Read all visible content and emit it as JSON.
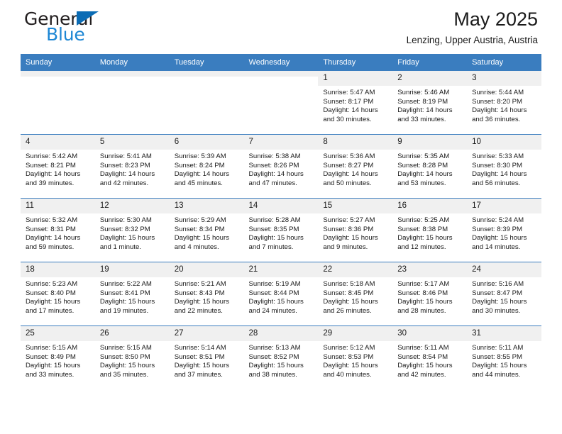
{
  "brand": {
    "word1": "General",
    "word2": "Blue",
    "triangle_color": "#0b6cb5",
    "blue_text_color": "#1c86d4"
  },
  "header": {
    "title": "May 2025",
    "subtitle": "Lenzing, Upper Austria, Austria"
  },
  "theme": {
    "header_bg": "#3a7dbf",
    "daynum_bg": "#f0f0f0",
    "grid_line": "#3a7dbf",
    "text": "#1a1a1a"
  },
  "calendar": {
    "weekday_headers": [
      "Sunday",
      "Monday",
      "Tuesday",
      "Wednesday",
      "Thursday",
      "Friday",
      "Saturday"
    ],
    "weeks": [
      [
        {
          "day": "",
          "empty": true,
          "sunrise": "",
          "sunset": "",
          "daylight1": "",
          "daylight2": ""
        },
        {
          "day": "",
          "empty": true,
          "sunrise": "",
          "sunset": "",
          "daylight1": "",
          "daylight2": ""
        },
        {
          "day": "",
          "empty": true,
          "sunrise": "",
          "sunset": "",
          "daylight1": "",
          "daylight2": ""
        },
        {
          "day": "",
          "empty": true,
          "sunrise": "",
          "sunset": "",
          "daylight1": "",
          "daylight2": ""
        },
        {
          "day": "1",
          "empty": false,
          "sunrise": "Sunrise: 5:47 AM",
          "sunset": "Sunset: 8:17 PM",
          "daylight1": "Daylight: 14 hours",
          "daylight2": "and 30 minutes."
        },
        {
          "day": "2",
          "empty": false,
          "sunrise": "Sunrise: 5:46 AM",
          "sunset": "Sunset: 8:19 PM",
          "daylight1": "Daylight: 14 hours",
          "daylight2": "and 33 minutes."
        },
        {
          "day": "3",
          "empty": false,
          "sunrise": "Sunrise: 5:44 AM",
          "sunset": "Sunset: 8:20 PM",
          "daylight1": "Daylight: 14 hours",
          "daylight2": "and 36 minutes."
        }
      ],
      [
        {
          "day": "4",
          "empty": false,
          "sunrise": "Sunrise: 5:42 AM",
          "sunset": "Sunset: 8:21 PM",
          "daylight1": "Daylight: 14 hours",
          "daylight2": "and 39 minutes."
        },
        {
          "day": "5",
          "empty": false,
          "sunrise": "Sunrise: 5:41 AM",
          "sunset": "Sunset: 8:23 PM",
          "daylight1": "Daylight: 14 hours",
          "daylight2": "and 42 minutes."
        },
        {
          "day": "6",
          "empty": false,
          "sunrise": "Sunrise: 5:39 AM",
          "sunset": "Sunset: 8:24 PM",
          "daylight1": "Daylight: 14 hours",
          "daylight2": "and 45 minutes."
        },
        {
          "day": "7",
          "empty": false,
          "sunrise": "Sunrise: 5:38 AM",
          "sunset": "Sunset: 8:26 PM",
          "daylight1": "Daylight: 14 hours",
          "daylight2": "and 47 minutes."
        },
        {
          "day": "8",
          "empty": false,
          "sunrise": "Sunrise: 5:36 AM",
          "sunset": "Sunset: 8:27 PM",
          "daylight1": "Daylight: 14 hours",
          "daylight2": "and 50 minutes."
        },
        {
          "day": "9",
          "empty": false,
          "sunrise": "Sunrise: 5:35 AM",
          "sunset": "Sunset: 8:28 PM",
          "daylight1": "Daylight: 14 hours",
          "daylight2": "and 53 minutes."
        },
        {
          "day": "10",
          "empty": false,
          "sunrise": "Sunrise: 5:33 AM",
          "sunset": "Sunset: 8:30 PM",
          "daylight1": "Daylight: 14 hours",
          "daylight2": "and 56 minutes."
        }
      ],
      [
        {
          "day": "11",
          "empty": false,
          "sunrise": "Sunrise: 5:32 AM",
          "sunset": "Sunset: 8:31 PM",
          "daylight1": "Daylight: 14 hours",
          "daylight2": "and 59 minutes."
        },
        {
          "day": "12",
          "empty": false,
          "sunrise": "Sunrise: 5:30 AM",
          "sunset": "Sunset: 8:32 PM",
          "daylight1": "Daylight: 15 hours",
          "daylight2": "and 1 minute."
        },
        {
          "day": "13",
          "empty": false,
          "sunrise": "Sunrise: 5:29 AM",
          "sunset": "Sunset: 8:34 PM",
          "daylight1": "Daylight: 15 hours",
          "daylight2": "and 4 minutes."
        },
        {
          "day": "14",
          "empty": false,
          "sunrise": "Sunrise: 5:28 AM",
          "sunset": "Sunset: 8:35 PM",
          "daylight1": "Daylight: 15 hours",
          "daylight2": "and 7 minutes."
        },
        {
          "day": "15",
          "empty": false,
          "sunrise": "Sunrise: 5:27 AM",
          "sunset": "Sunset: 8:36 PM",
          "daylight1": "Daylight: 15 hours",
          "daylight2": "and 9 minutes."
        },
        {
          "day": "16",
          "empty": false,
          "sunrise": "Sunrise: 5:25 AM",
          "sunset": "Sunset: 8:38 PM",
          "daylight1": "Daylight: 15 hours",
          "daylight2": "and 12 minutes."
        },
        {
          "day": "17",
          "empty": false,
          "sunrise": "Sunrise: 5:24 AM",
          "sunset": "Sunset: 8:39 PM",
          "daylight1": "Daylight: 15 hours",
          "daylight2": "and 14 minutes."
        }
      ],
      [
        {
          "day": "18",
          "empty": false,
          "sunrise": "Sunrise: 5:23 AM",
          "sunset": "Sunset: 8:40 PM",
          "daylight1": "Daylight: 15 hours",
          "daylight2": "and 17 minutes."
        },
        {
          "day": "19",
          "empty": false,
          "sunrise": "Sunrise: 5:22 AM",
          "sunset": "Sunset: 8:41 PM",
          "daylight1": "Daylight: 15 hours",
          "daylight2": "and 19 minutes."
        },
        {
          "day": "20",
          "empty": false,
          "sunrise": "Sunrise: 5:21 AM",
          "sunset": "Sunset: 8:43 PM",
          "daylight1": "Daylight: 15 hours",
          "daylight2": "and 22 minutes."
        },
        {
          "day": "21",
          "empty": false,
          "sunrise": "Sunrise: 5:19 AM",
          "sunset": "Sunset: 8:44 PM",
          "daylight1": "Daylight: 15 hours",
          "daylight2": "and 24 minutes."
        },
        {
          "day": "22",
          "empty": false,
          "sunrise": "Sunrise: 5:18 AM",
          "sunset": "Sunset: 8:45 PM",
          "daylight1": "Daylight: 15 hours",
          "daylight2": "and 26 minutes."
        },
        {
          "day": "23",
          "empty": false,
          "sunrise": "Sunrise: 5:17 AM",
          "sunset": "Sunset: 8:46 PM",
          "daylight1": "Daylight: 15 hours",
          "daylight2": "and 28 minutes."
        },
        {
          "day": "24",
          "empty": false,
          "sunrise": "Sunrise: 5:16 AM",
          "sunset": "Sunset: 8:47 PM",
          "daylight1": "Daylight: 15 hours",
          "daylight2": "and 30 minutes."
        }
      ],
      [
        {
          "day": "25",
          "empty": false,
          "sunrise": "Sunrise: 5:15 AM",
          "sunset": "Sunset: 8:49 PM",
          "daylight1": "Daylight: 15 hours",
          "daylight2": "and 33 minutes."
        },
        {
          "day": "26",
          "empty": false,
          "sunrise": "Sunrise: 5:15 AM",
          "sunset": "Sunset: 8:50 PM",
          "daylight1": "Daylight: 15 hours",
          "daylight2": "and 35 minutes."
        },
        {
          "day": "27",
          "empty": false,
          "sunrise": "Sunrise: 5:14 AM",
          "sunset": "Sunset: 8:51 PM",
          "daylight1": "Daylight: 15 hours",
          "daylight2": "and 37 minutes."
        },
        {
          "day": "28",
          "empty": false,
          "sunrise": "Sunrise: 5:13 AM",
          "sunset": "Sunset: 8:52 PM",
          "daylight1": "Daylight: 15 hours",
          "daylight2": "and 38 minutes."
        },
        {
          "day": "29",
          "empty": false,
          "sunrise": "Sunrise: 5:12 AM",
          "sunset": "Sunset: 8:53 PM",
          "daylight1": "Daylight: 15 hours",
          "daylight2": "and 40 minutes."
        },
        {
          "day": "30",
          "empty": false,
          "sunrise": "Sunrise: 5:11 AM",
          "sunset": "Sunset: 8:54 PM",
          "daylight1": "Daylight: 15 hours",
          "daylight2": "and 42 minutes."
        },
        {
          "day": "31",
          "empty": false,
          "sunrise": "Sunrise: 5:11 AM",
          "sunset": "Sunset: 8:55 PM",
          "daylight1": "Daylight: 15 hours",
          "daylight2": "and 44 minutes."
        }
      ]
    ]
  }
}
